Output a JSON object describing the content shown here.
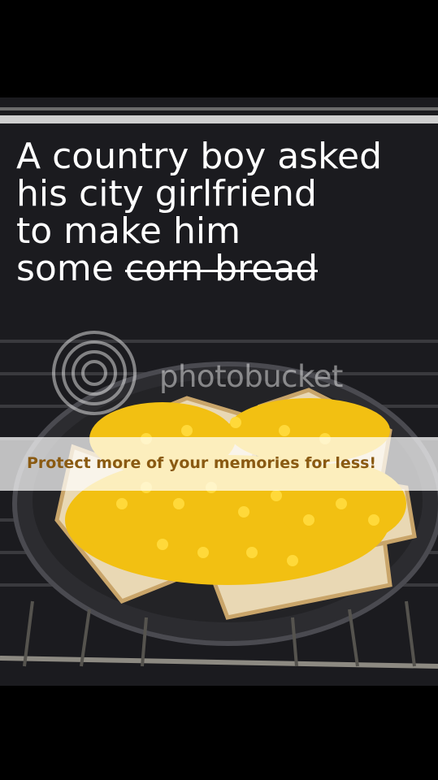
{
  "caption": {
    "line1": "A country boy asked",
    "line2": "his city girlfriend",
    "line3": "to make him",
    "line4_prefix": "some ",
    "line4_struck": "corn bread"
  },
  "watermark": {
    "brand": "photobucket"
  },
  "banner": {
    "text": "Protect more of your memories for less!"
  },
  "colors": {
    "corn": "#f5c518",
    "bread": "#e8d6b0",
    "pan": "#2a2a2e",
    "background": "#000000"
  }
}
